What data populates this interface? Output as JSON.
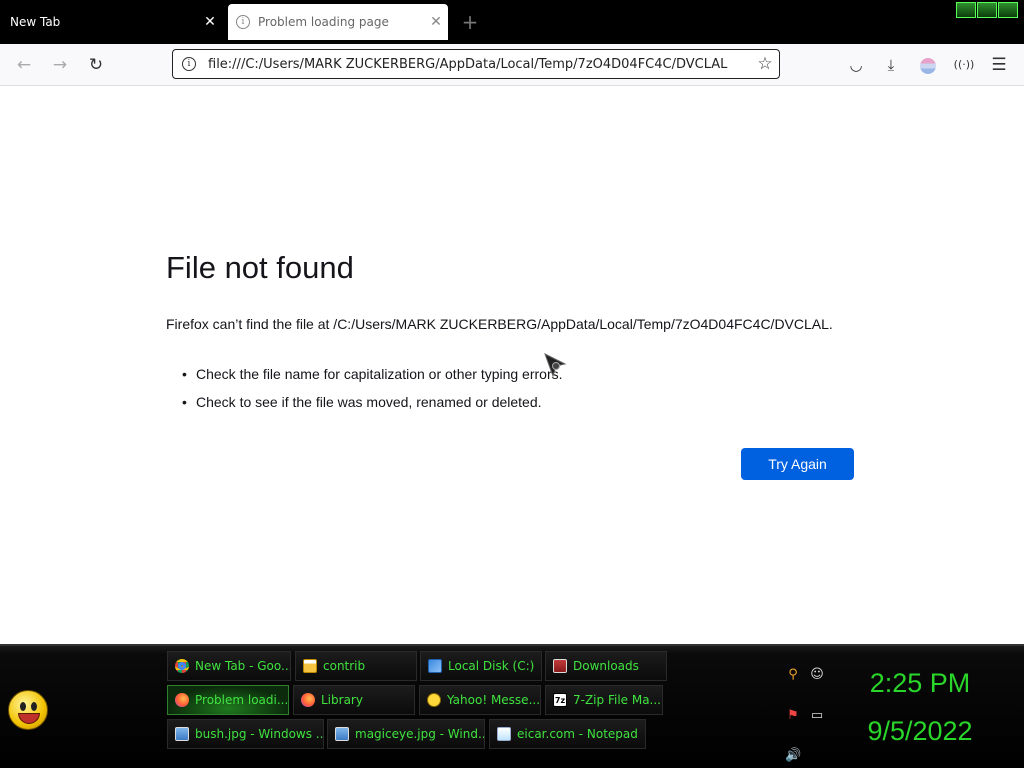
{
  "tabs": [
    {
      "title": "New Tab",
      "close": "✕"
    },
    {
      "title": "Problem loading page",
      "close": "✕"
    }
  ],
  "toolbar": {
    "new_tab": "+",
    "back": "←",
    "forward": "→",
    "reload": "↻",
    "url": "file:///C:/Users/MARK ZUCKERBERG/AppData/Local/Temp/7zO4D04FC4C/DVCLAL",
    "bookmark": "☆",
    "pocket": "◡",
    "downloads": "⤓",
    "media": "((·))",
    "menu": "☰"
  },
  "error": {
    "title": "File not found",
    "description": "Firefox can’t find the file at /C:/Users/MARK ZUCKERBERG/AppData/Local/Temp/7zO4D04FC4C/DVCLAL.",
    "suggestions": [
      "Check the file name for capitalization or other typing errors.",
      "Check to see if the file was moved, renamed or deleted."
    ],
    "try_again": "Try Again"
  },
  "taskbar": {
    "buttons": [
      {
        "label": "New Tab - Goo...",
        "icon": "chrome-icon"
      },
      {
        "label": "contrib",
        "icon": "folder-icon"
      },
      {
        "label": "Local Disk (C:)",
        "icon": "drive-icon"
      },
      {
        "label": "Downloads",
        "icon": "downloads-folder-icon"
      },
      {
        "label": "Problem loadi...",
        "icon": "firefox-icon"
      },
      {
        "label": "Library",
        "icon": "firefox-icon"
      },
      {
        "label": "Yahoo! Messe...",
        "icon": "yahoo-messenger-icon"
      },
      {
        "label": "7-Zip File Ma...",
        "icon": "7zip-icon"
      },
      {
        "label": "bush.jpg - Windows ...",
        "icon": "image-viewer-icon"
      },
      {
        "label": "magiceye.jpg - Wind...",
        "icon": "image-viewer-icon"
      },
      {
        "label": "eicar.com - Notepad",
        "icon": "notepad-icon"
      }
    ],
    "seven_zip_glyph": "7z",
    "clock_time": "2:25 PM",
    "clock_date": "9/5/2022"
  },
  "colors": {
    "accent_button": "#0061e0",
    "taskbar_text": "#3fe33f",
    "clock": "#29d629"
  }
}
